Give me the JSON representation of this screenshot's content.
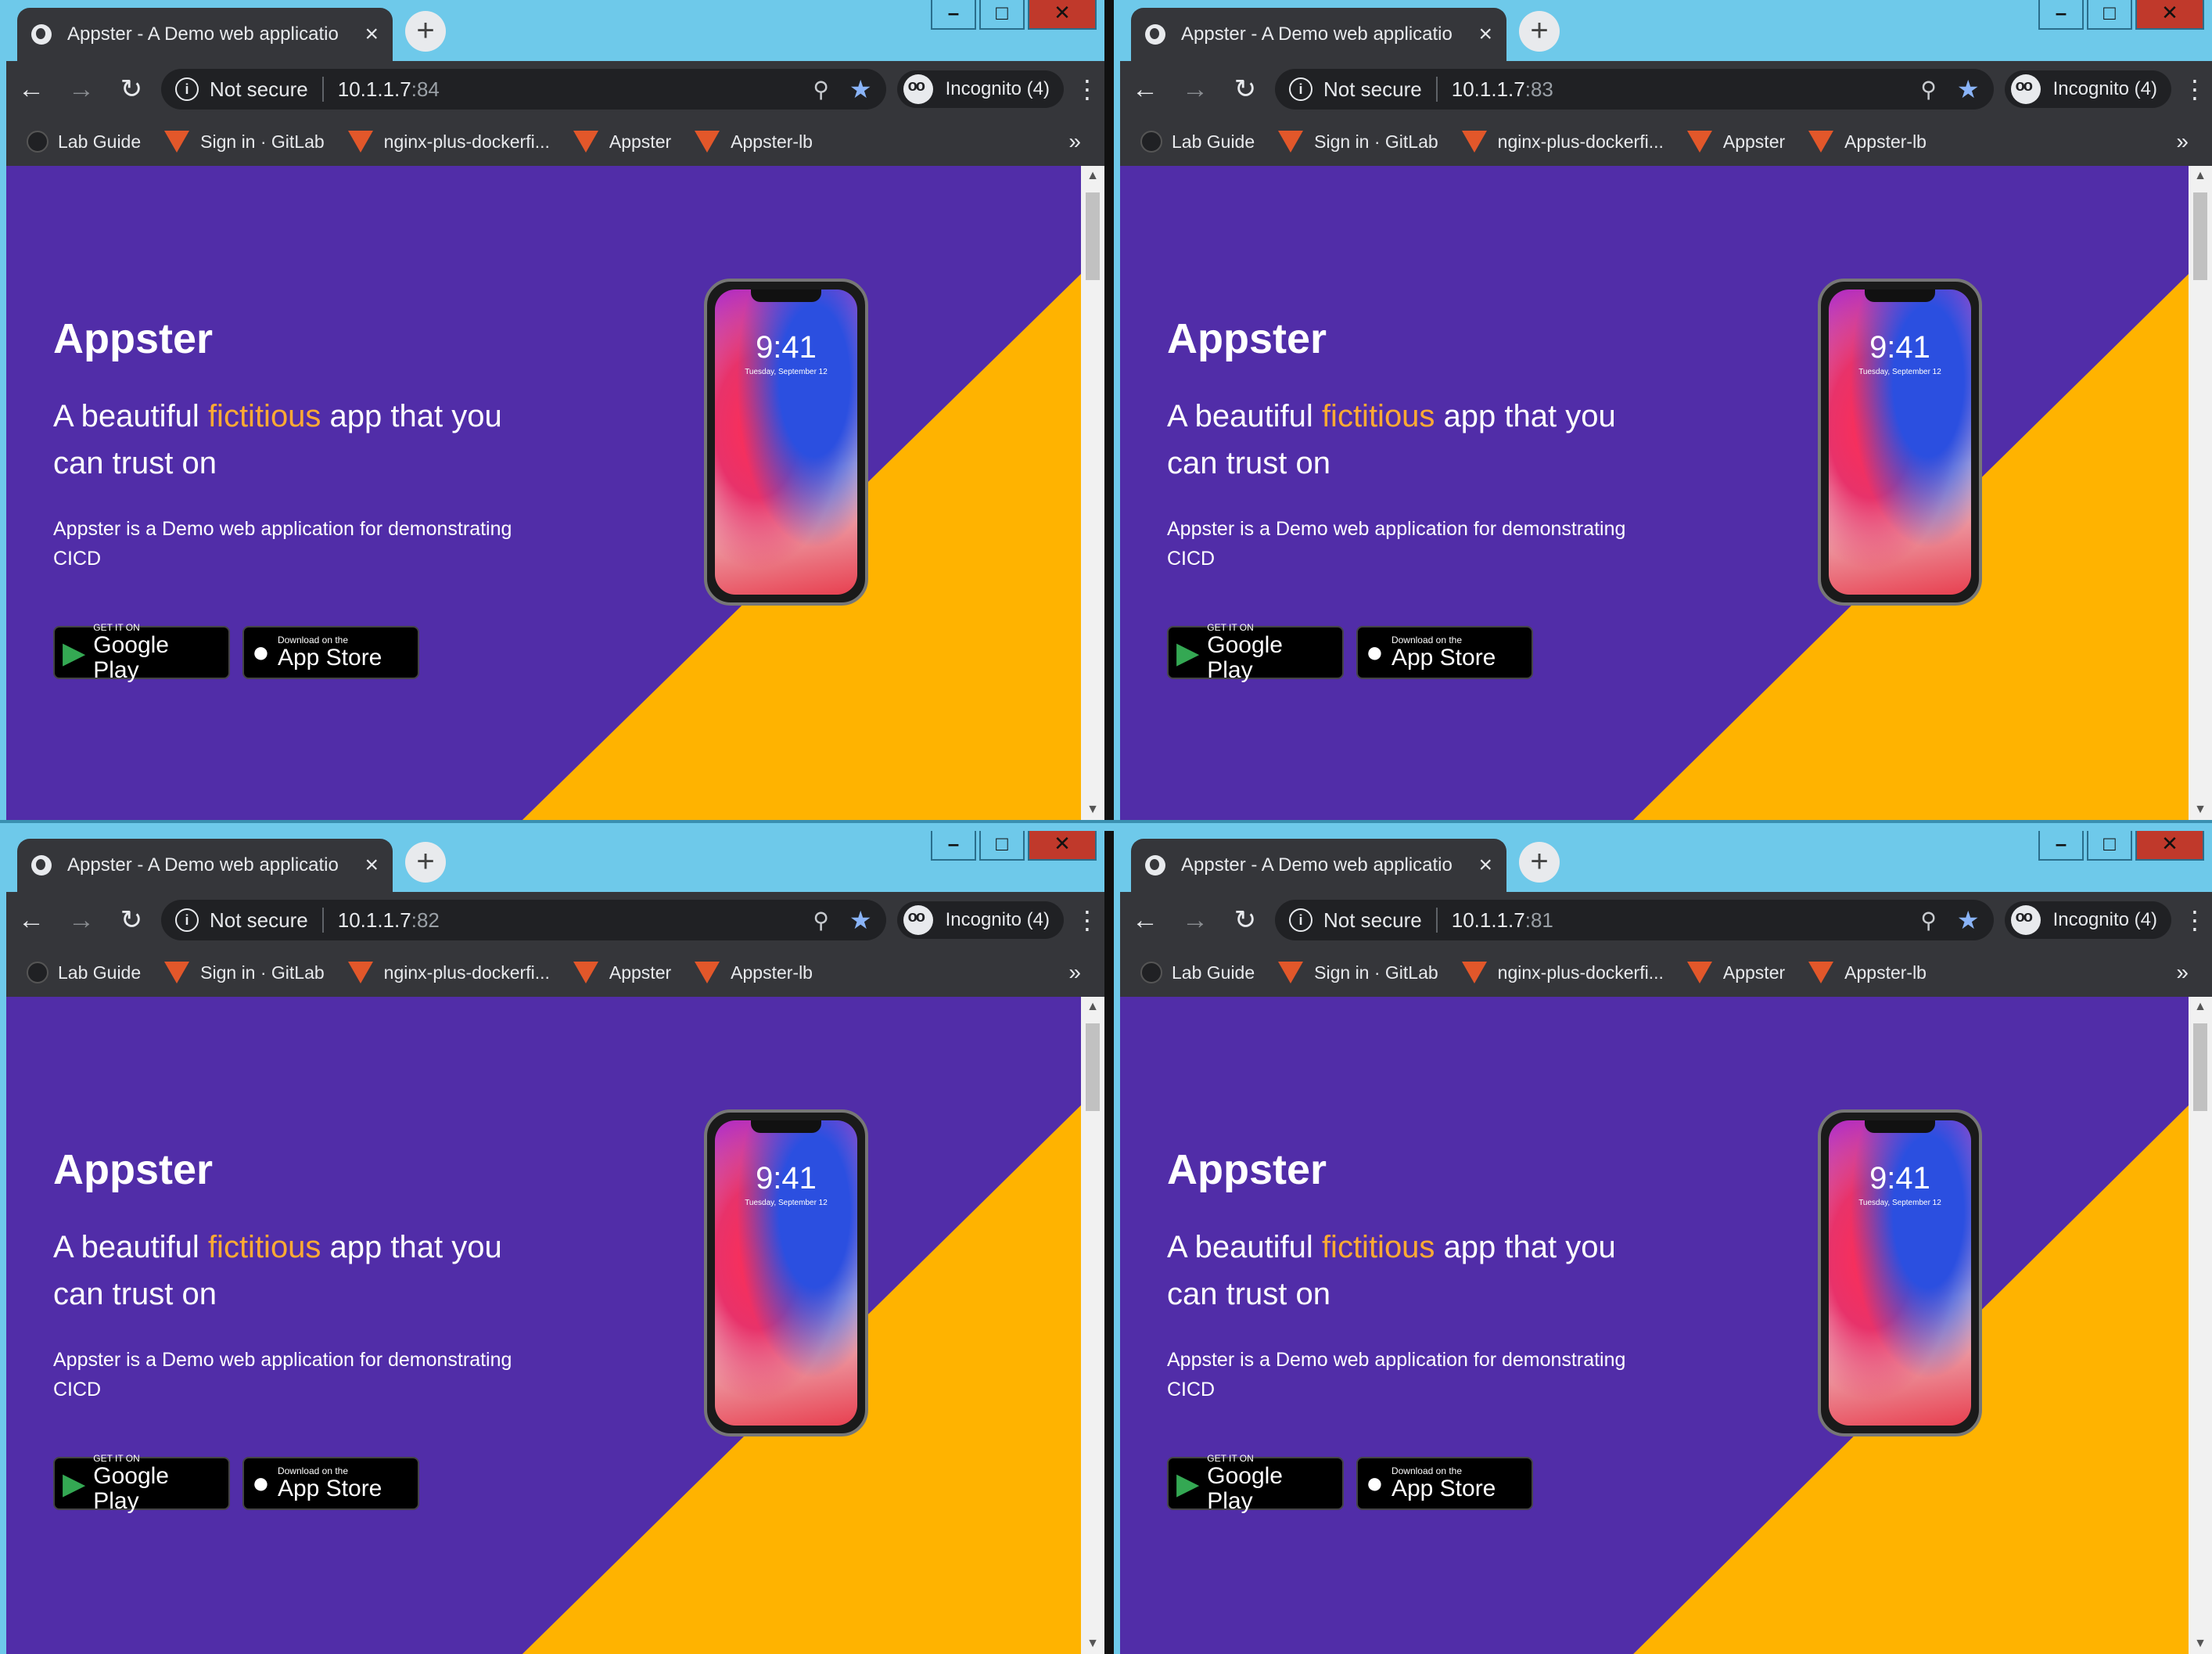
{
  "windows": [
    {
      "tab_title": "Appster - A Demo web applicatio",
      "url_security": "Not secure",
      "url_host": "10.1.1.7",
      "url_port": ":84",
      "incognito_label": "Incognito (4)"
    },
    {
      "tab_title": "Appster - A Demo web applicatio",
      "url_security": "Not secure",
      "url_host": "10.1.1.7",
      "url_port": ":83",
      "incognito_label": "Incognito (4)"
    },
    {
      "tab_title": "Appster - A Demo web applicatio",
      "url_security": "Not secure",
      "url_host": "10.1.1.7",
      "url_port": ":82",
      "incognito_label": "Incognito (4)"
    },
    {
      "tab_title": "Appster - A Demo web applicatio",
      "url_security": "Not secure",
      "url_host": "10.1.1.7",
      "url_port": ":81",
      "incognito_label": "Incognito (4)"
    }
  ],
  "bookmarks": [
    {
      "label": "Lab Guide",
      "icon": "github-icon"
    },
    {
      "label": "Sign in · GitLab",
      "icon": "gitlab-icon"
    },
    {
      "label": "nginx-plus-dockerfi...",
      "icon": "gitlab-icon"
    },
    {
      "label": "Appster",
      "icon": "gitlab-icon"
    },
    {
      "label": "Appster-lb",
      "icon": "gitlab-icon"
    }
  ],
  "page": {
    "title": "Appster",
    "subtitle_pre": "A beautiful ",
    "subtitle_highlight": "fictitious",
    "subtitle_post": " app that you can trust on",
    "description": "Appster is a Demo web application for demonstrating CICD",
    "google_play_small": "GET IT ON",
    "google_play_big": "Google Play",
    "app_store_small": "Download on the",
    "app_store_big": "App Store",
    "phone_time": "9:41",
    "phone_date": "Tuesday, September 12"
  },
  "colors": {
    "page_purple": "#512da8",
    "page_orange": "#ffb300",
    "highlight": "#ffaa33",
    "chrome_dark": "#35363a",
    "desktop_blue": "#6ec9ea"
  }
}
